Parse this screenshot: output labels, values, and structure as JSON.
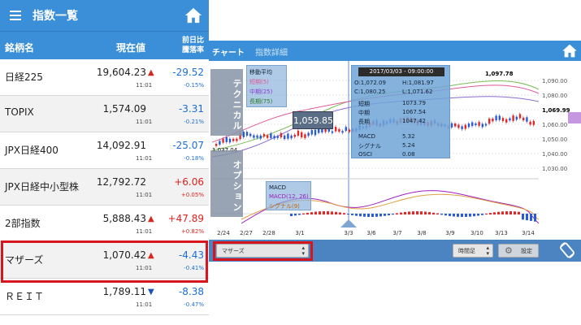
{
  "phone": {
    "header_title": "指数一覧",
    "columns": {
      "name": "銘柄名",
      "price": "現在値",
      "change_line1": "前日比",
      "change_line2": "騰落率"
    },
    "rows": [
      {
        "name": "日経225",
        "price": "19,604.23",
        "dir": "up",
        "time": "11:01",
        "change": "-29.52",
        "pct": "-0.15%",
        "sign": "minus"
      },
      {
        "name": "TOPIX",
        "price": "1,574.09",
        "dir": "",
        "time": "11:01",
        "change": "-3.31",
        "pct": "-0.21%",
        "sign": "minus"
      },
      {
        "name": "JPX日経400",
        "price": "14,092.91",
        "dir": "",
        "time": "11:01",
        "change": "-25.07",
        "pct": "-0.18%",
        "sign": "minus"
      },
      {
        "name": "JPX日経中小型株",
        "price": "12,792.72",
        "dir": "",
        "time": "11:01",
        "change": "+6.06",
        "pct": "+0.05%",
        "sign": "plus"
      },
      {
        "name": "2部指数",
        "price": "5,888.43",
        "dir": "up",
        "time": "11:01",
        "change": "+47.89",
        "pct": "+0.82%",
        "sign": "plus"
      },
      {
        "name": "マザーズ",
        "price": "1,070.42",
        "dir": "up",
        "time": "11:01",
        "change": "-4.43",
        "pct": "-0.41%",
        "sign": "minus"
      },
      {
        "name": "ＲＥＩＴ",
        "price": "1,789.11",
        "dir": "down",
        "time": "11:01",
        "change": "-8.38",
        "pct": "-0.47%",
        "sign": "minus"
      }
    ]
  },
  "tablet": {
    "tabs": {
      "chart": "チャート",
      "detail": "指数詳細"
    },
    "side_tabs": {
      "technical": "テクニカル",
      "option": "オプション"
    },
    "indicator_legend": {
      "title": "移動平均",
      "short": "短期(5)",
      "mid": "中期(25)",
      "long": "長期(75)"
    },
    "macd_legend": {
      "macd": "MACD",
      "params": "MACD(12, 26)",
      "signal": "シグナル(9)"
    },
    "tooltip": {
      "date": "2017/03/03 - 09:00:00",
      "o": "O:1,072.09",
      "h": "H:1,081.97",
      "c": "C:1,080.25",
      "l": "L:1,071.62",
      "rows": [
        {
          "label": "短期",
          "value": "1073.79"
        },
        {
          "label": "中期",
          "value": "1067.54"
        },
        {
          "label": "長期",
          "value": "1047.42"
        },
        {
          "label": "MACD",
          "value": "5.32"
        },
        {
          "label": "シグナル",
          "value": "5.24"
        },
        {
          "label": "OSCI",
          "value": "0.08"
        }
      ]
    },
    "price_flag": "1,059.85",
    "high_label": "1,097.78",
    "low_label": "1,037.04",
    "y_axis": [
      "1,090.00",
      "1,080.00",
      "1,069.99",
      "1,060.00",
      "1,050.00",
      "1,040.00",
      "1,030.00"
    ],
    "x_axis": [
      "2/24",
      "2/27",
      "2/28",
      "3/1",
      "3/3",
      "3/6",
      "3/7",
      "3/8",
      "3/9",
      "3/10",
      "3/13",
      "3/14"
    ],
    "index_select": "マザーズ",
    "period_select": "時間足",
    "settings_label": "設定",
    "colors": {
      "header": "#3a8fd8",
      "short_ma": "#e05a9a",
      "mid_ma": "#8a6ccf",
      "long_ma": "#7cbd5a",
      "up_candle": "#e02828",
      "down_candle": "#2a5bd6"
    }
  }
}
